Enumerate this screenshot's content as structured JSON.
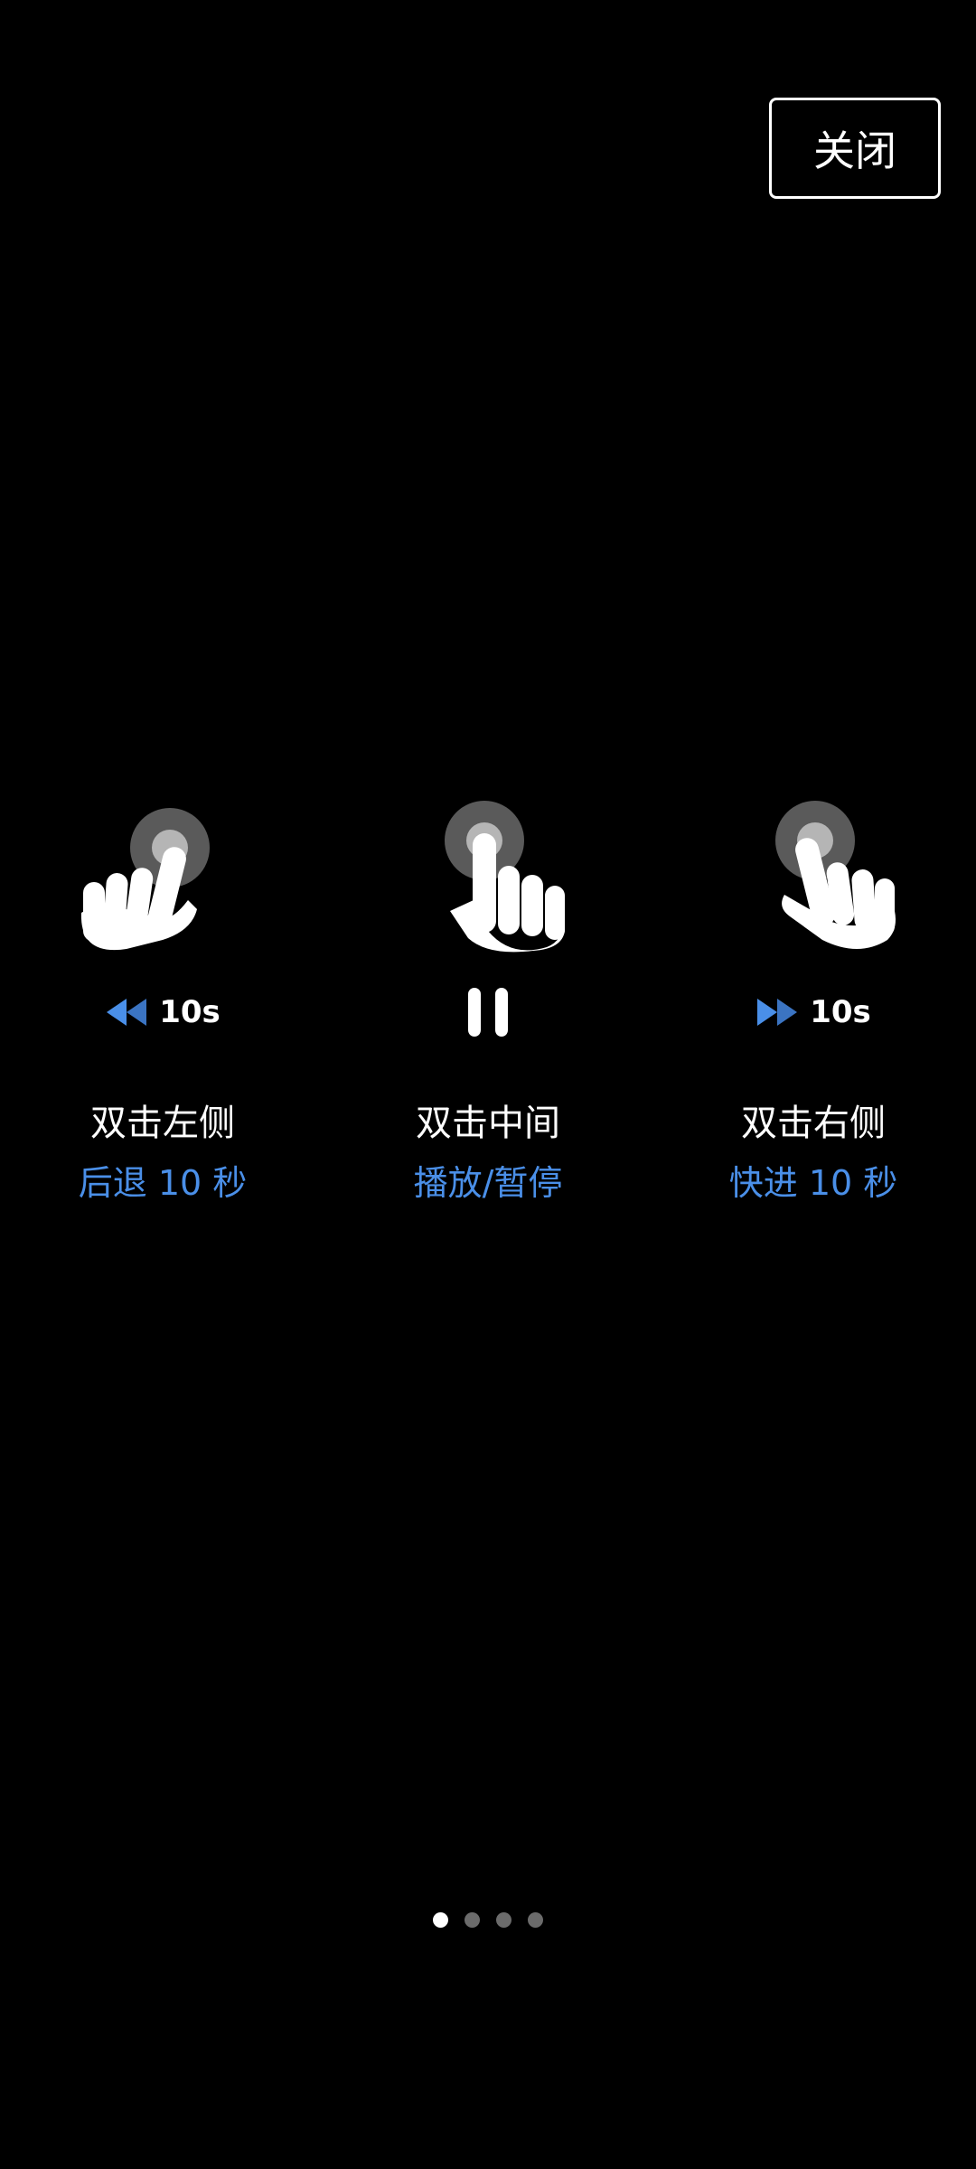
{
  "header": {
    "close_label": "关闭"
  },
  "gestures": [
    {
      "title": "双击左侧",
      "subtitle": "后退 10 秒",
      "indicator_label": "10s",
      "indicator_icon": "rewind-icon"
    },
    {
      "title": "双击中间",
      "subtitle": "播放/暂停",
      "indicator_icon": "pause-icon"
    },
    {
      "title": "双击右侧",
      "subtitle": "快进 10 秒",
      "indicator_label": "10s",
      "indicator_icon": "fast-forward-icon"
    }
  ],
  "pagination": {
    "total": 4,
    "current": 1
  },
  "colors": {
    "background": "#000000",
    "accent": "#4a8fe8",
    "text": "#ffffff",
    "dot_inactive": "#6b6b6b"
  }
}
